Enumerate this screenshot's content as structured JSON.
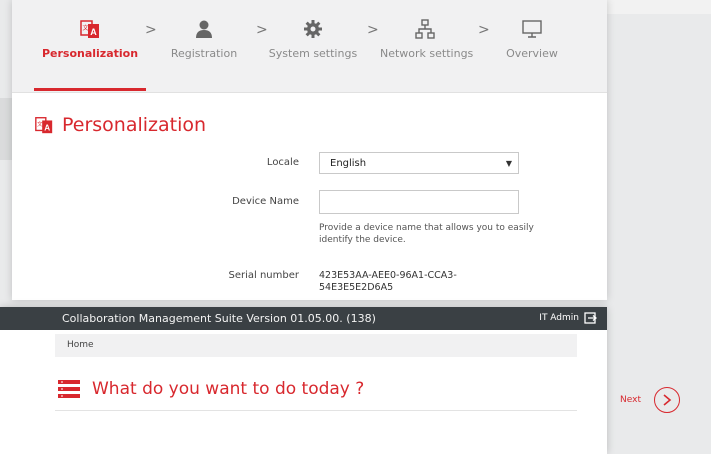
{
  "wizard": {
    "steps": [
      {
        "label": "Personalization",
        "icon": "language-icon",
        "active": true
      },
      {
        "label": "Registration",
        "icon": "user-icon",
        "active": false
      },
      {
        "label": "System settings",
        "icon": "gear-icon",
        "active": false
      },
      {
        "label": "Network settings",
        "icon": "network-icon",
        "active": false
      },
      {
        "label": "Overview",
        "icon": "monitor-icon",
        "active": false
      }
    ],
    "step_separator": ">",
    "section_title": "Personalization",
    "fields": {
      "locale_label": "Locale",
      "locale_value": "English",
      "device_name_label": "Device Name",
      "device_name_value": "",
      "device_name_hint": "Provide a device name that allows you to easily identify the device.",
      "serial_label": "Serial number",
      "serial_value": "423E53AA-AEE0-96A1-CCA3-",
      "serial_value_cont": "54E3E5E2D6A5"
    },
    "accent_color": "#d8282e"
  },
  "main": {
    "app_title": "Collaboration Management Suite Version 01.05.00. (138)",
    "user_label": "IT Admin",
    "breadcrumb": "Home",
    "heading": "What do you want to do today ?"
  },
  "next_label": "Next"
}
